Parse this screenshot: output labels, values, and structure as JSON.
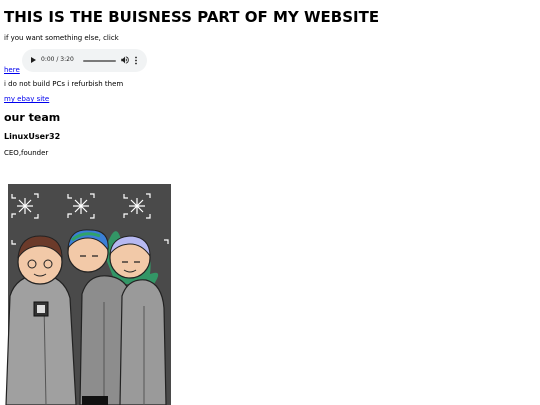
{
  "page": {
    "title": "THIS IS THE BUISNESS PART OF MY WEBSITE",
    "intro_text": "if you want something else, click",
    "here_link": "here",
    "notice_text": "i do not build PCs i refurbish them",
    "ebay_link": "my ebay site"
  },
  "audio": {
    "time_display": "0:00 / 3:20",
    "progress": 0,
    "icons": [
      "play-icon",
      "volume-icon",
      "more-options-icon"
    ]
  },
  "team": {
    "heading": "our team",
    "member_name": "LinuxUser32",
    "member_role": "CEO,founder"
  },
  "colors": {
    "link": "#0000ee",
    "player_background": "#f1f3f4",
    "picture_background": "#4a4a4a",
    "hoodie": "#9a9a9a"
  }
}
